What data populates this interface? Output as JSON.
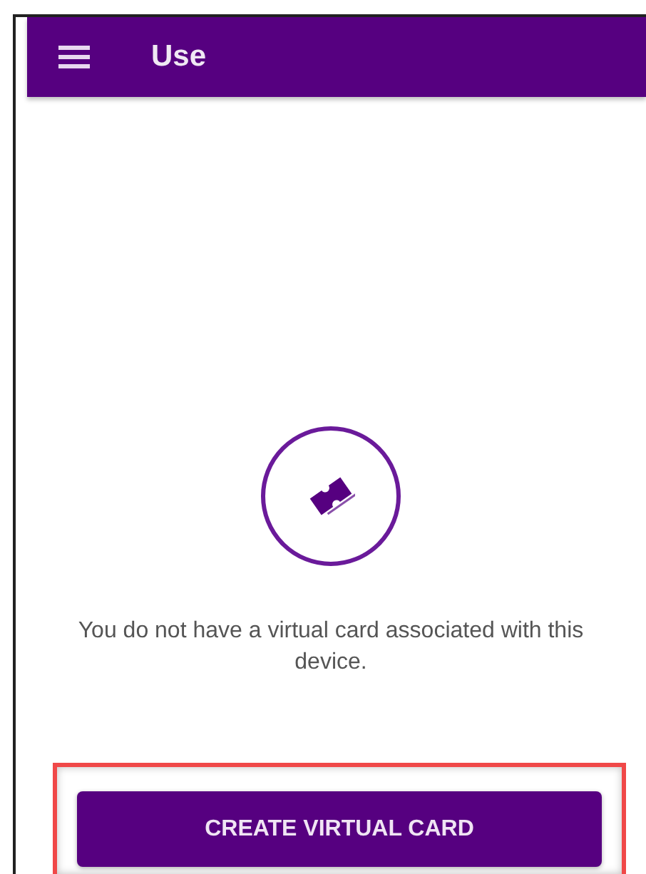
{
  "app_bar": {
    "title": "Use"
  },
  "empty_state": {
    "message": "You do not have a virtual card associated with this device."
  },
  "button": {
    "label": "CREATE VIRTUAL CARD"
  }
}
